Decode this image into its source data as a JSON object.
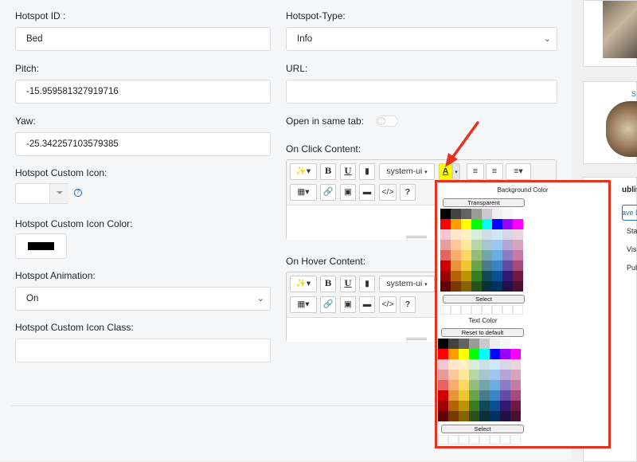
{
  "form": {
    "hotspot_id_label": "Hotspot ID :",
    "hotspot_id_value": "Bed",
    "pitch_label": "Pitch:",
    "pitch_value": "-15.959581327919716",
    "yaw_label": "Yaw:",
    "yaw_value": "-25.342257103579385",
    "custom_icon_label": "Hotspot Custom Icon:",
    "custom_icon_color_label": "Hotspot Custom Icon Color:",
    "custom_icon_color": "#000000",
    "animation_label": "Hotspot Animation:",
    "animation_value": "On",
    "custom_icon_class_label": "Hotspot Custom Icon Class:",
    "type_label": "Hotspot-Type:",
    "type_value": "Info",
    "url_label": "URL:",
    "url_value": "",
    "same_tab_label": "Open in same tab:",
    "on_click_label": "On Click Content:",
    "on_hover_label": "On Hover Content:"
  },
  "toolbar": {
    "font_name": "system-ui",
    "code_label": "</>",
    "help_label": "?"
  },
  "color_popup": {
    "background_title": "Background Color",
    "transparent_label": "Transparent",
    "select_label": "Select",
    "text_title": "Text Color",
    "reset_label": "Reset to default",
    "select_label_2": "Select",
    "palette": [
      [
        "#000000",
        "#424242",
        "#636363",
        "#9c9c94",
        "#cec6ce",
        "#efefef",
        "#f7f7f7",
        "#ffffff"
      ],
      [
        "#ff0000",
        "#ff9c00",
        "#ffff00",
        "#00ff00",
        "#00ffff",
        "#0000ff",
        "#9c00ff",
        "#ff00ff"
      ],
      [
        "#f7c6ce",
        "#ffe7ce",
        "#ffefc6",
        "#d6efd6",
        "#cedee7",
        "#cee7f7",
        "#d6d6e7",
        "#e7d6de"
      ],
      [
        "#e79c9c",
        "#ffc69c",
        "#ffe79c",
        "#b5d6a5",
        "#a5c6ce",
        "#9cc6ef",
        "#b5a5d6",
        "#d6a5bd"
      ],
      [
        "#e76363",
        "#f7ad6b",
        "#ffd663",
        "#94bd7b",
        "#73a5ad",
        "#6badde",
        "#8c7bc6",
        "#c67ba5"
      ],
      [
        "#ce0000",
        "#e79439",
        "#efc631",
        "#6ba54a",
        "#4a7b8c",
        "#3984c6",
        "#634aa5",
        "#a54a7b"
      ],
      [
        "#9c0000",
        "#b56308",
        "#bd9400",
        "#397b21",
        "#104a5a",
        "#085294",
        "#311873",
        "#731842"
      ],
      [
        "#630000",
        "#7b3900",
        "#846300",
        "#295218",
        "#083139",
        "#003163",
        "#21104a",
        "#4a1031"
      ]
    ]
  },
  "sidebar": {
    "publish_label": "ublish",
    "save_draft_label": "ave Draf",
    "status_label": "Status:",
    "visibility_label": "Visibilit",
    "publish_date_label": "Publish",
    "link_label": "S"
  }
}
